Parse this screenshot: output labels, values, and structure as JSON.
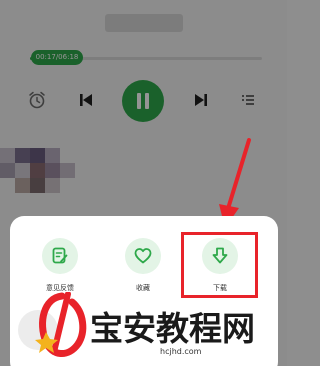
{
  "player": {
    "progress_time": "00:17/06:18",
    "progress_fraction": 0.08,
    "accent": "#2ea84a",
    "controls": [
      "alarm-icon",
      "previous-icon",
      "pause-icon",
      "next-icon",
      "playlist-icon"
    ]
  },
  "sheet": {
    "actions": [
      {
        "label": "意见反馈",
        "icon": "feedback-edit-icon"
      },
      {
        "label": "收藏",
        "icon": "heart-icon"
      },
      {
        "label": "下载",
        "icon": "download-arrow-icon"
      }
    ]
  },
  "annotation": {
    "color": "#e8232a"
  },
  "watermark": {
    "title": "宝安教程网",
    "url": "hcjhd.com"
  }
}
